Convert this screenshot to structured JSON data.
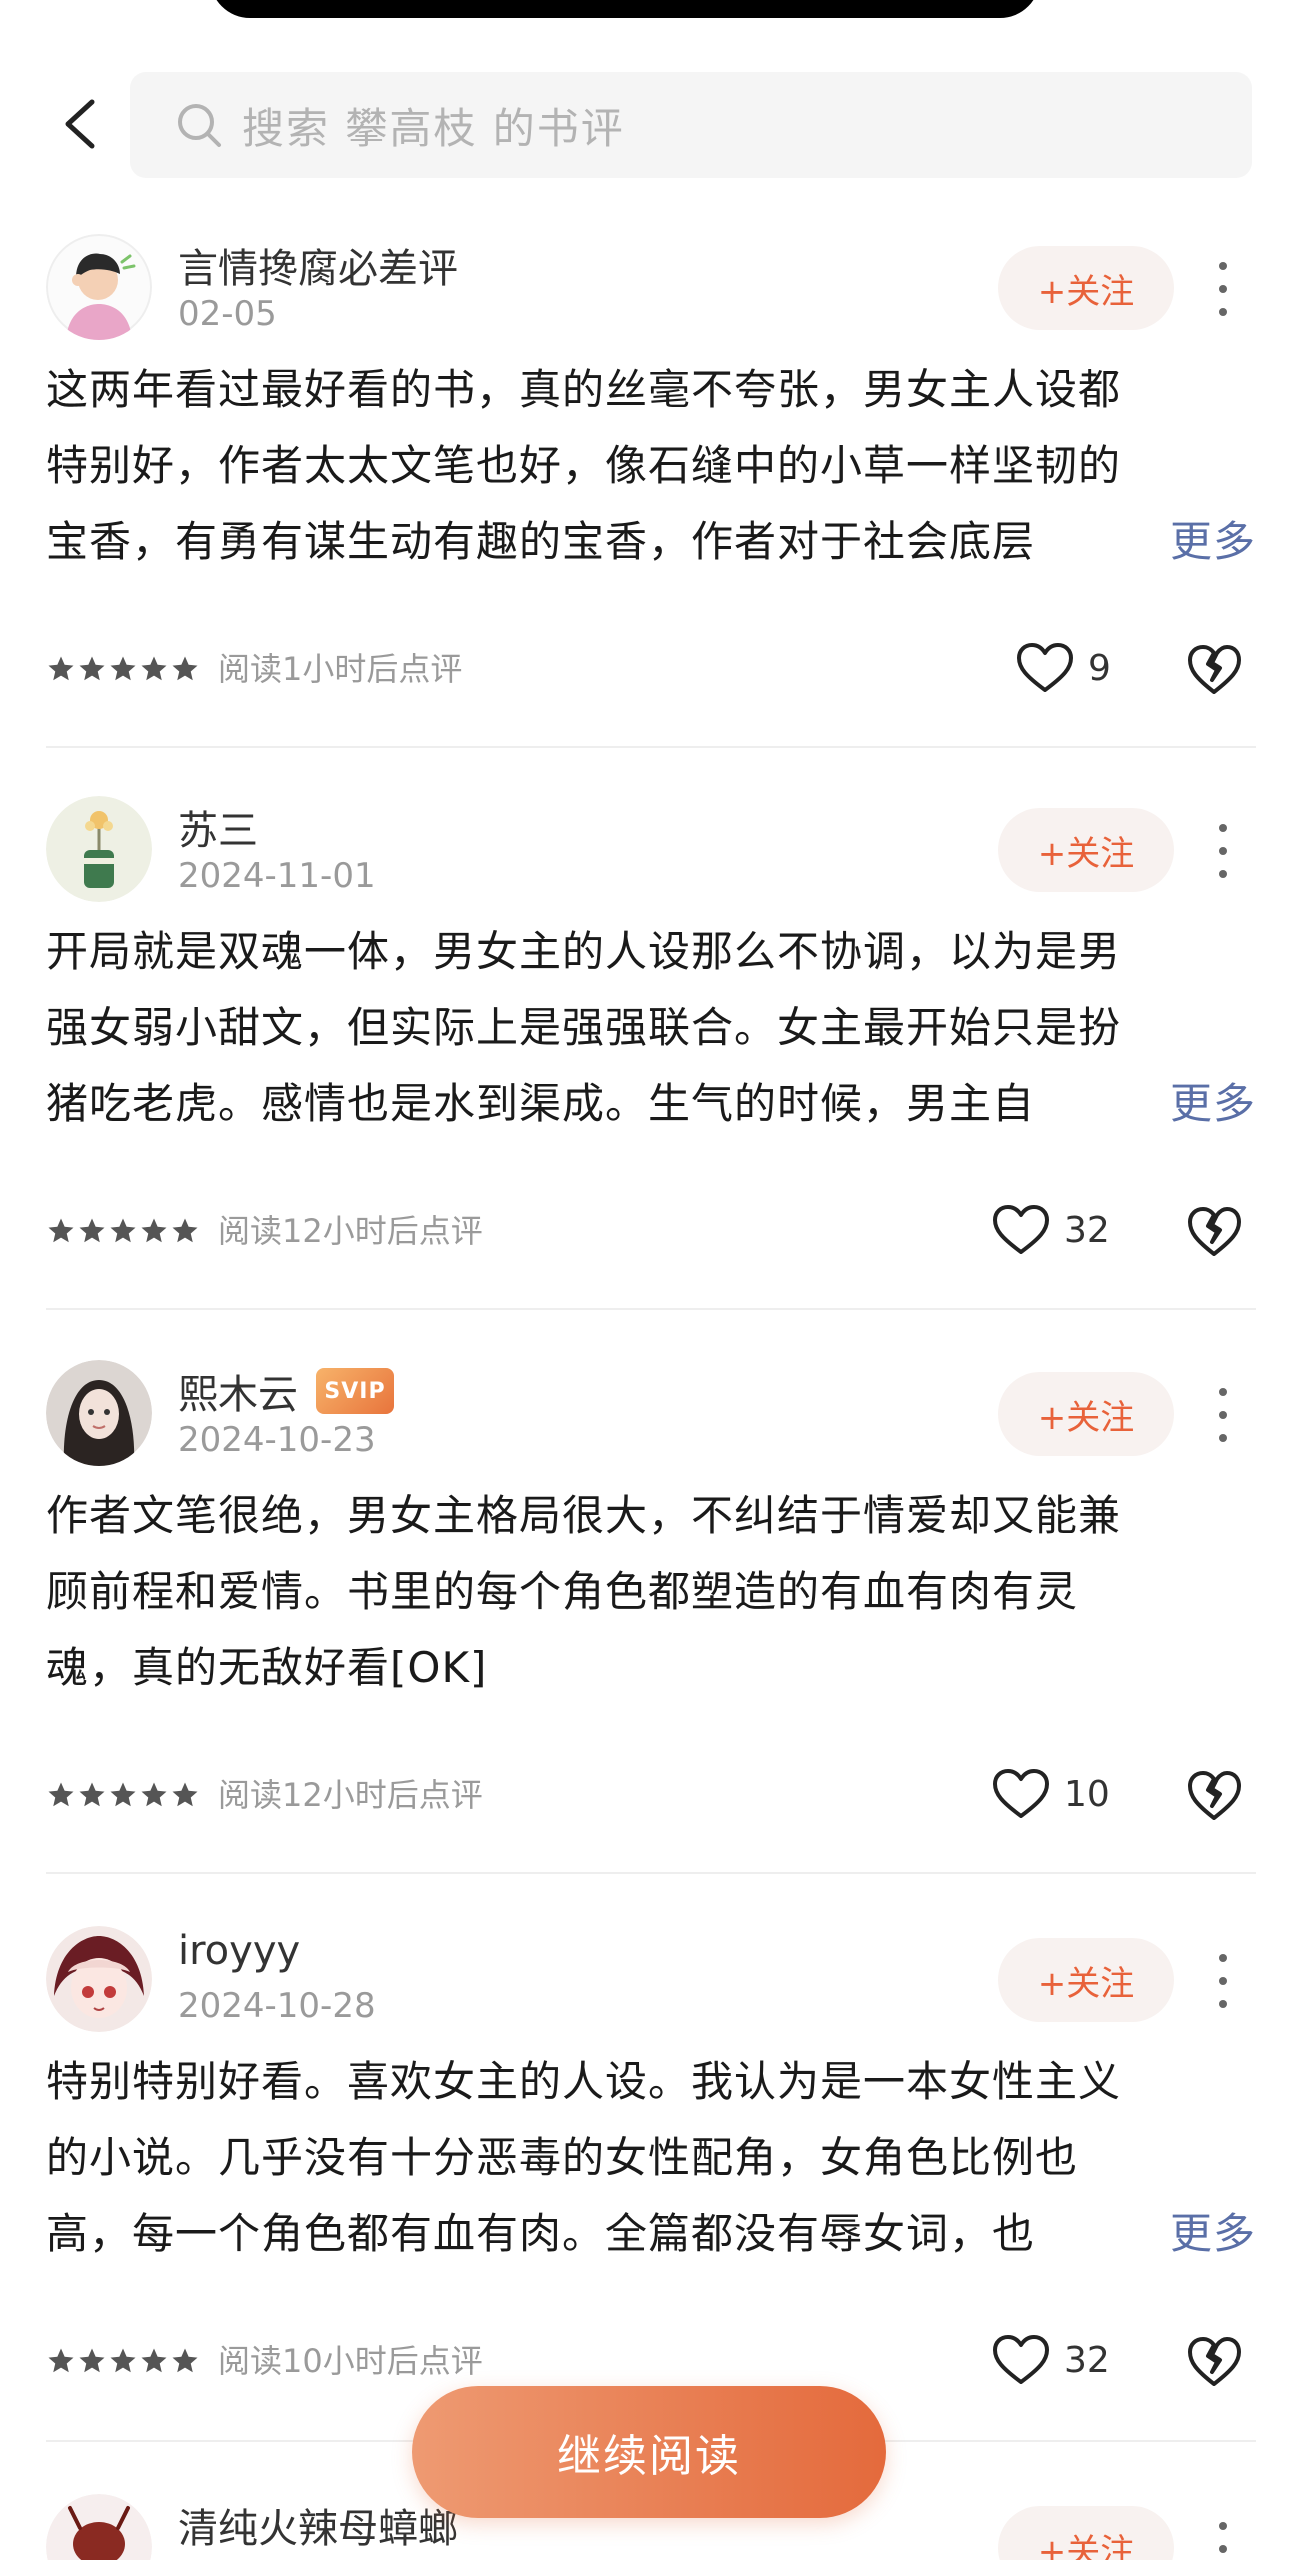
{
  "search": {
    "placeholder": "搜索 攀高枝 的书评"
  },
  "reviews": [
    {
      "username": "言情搀腐必差评",
      "date": "02-05",
      "follow_label": "+关注",
      "lines": [
        "这两年看过最好看的书，真的丝毫不夸张，男女主人设都",
        "特别好，作者太太文笔也好，像石缝中的小草一样坚韧的",
        "宝香，有勇有谋生动有趣的宝香，作者对于社会底层"
      ],
      "more_label": "更多",
      "read_note": "阅读1小时后点评",
      "likes": "9",
      "rating": 5
    },
    {
      "username": "苏三",
      "date": "2024-11-01",
      "follow_label": "+关注",
      "lines": [
        "开局就是双魂一体，男女主的人设那么不协调，以为是男",
        "强女弱小甜文，但实际上是强强联合。女主最开始只是扮",
        "猪吃老虎。感情也是水到渠成。生气的时候，男主自"
      ],
      "more_label": "更多",
      "read_note": "阅读12小时后点评",
      "likes": "32",
      "rating": 5
    },
    {
      "username": "熙木云",
      "badge": "SVIP",
      "date": "2024-10-23",
      "follow_label": "+关注",
      "lines": [
        "作者文笔很绝，男女主格局很大，不纠结于情爱却又能兼",
        "顾前程和爱情。书里的每个角色都塑造的有血有肉有灵",
        "魂，真的无敌好看[OK]"
      ],
      "read_note": "阅读12小时后点评",
      "likes": "10",
      "rating": 5
    },
    {
      "username": "iroyyy",
      "date": "2024-10-28",
      "follow_label": "+关注",
      "lines": [
        "特别特别好看。喜欢女主的人设。我认为是一本女性主义",
        "的小说。几乎没有十分恶毒的女性配角，女角色比例也",
        "高，每一个角色都有血有肉。全篇都没有辱女词，也"
      ],
      "more_label": "更多",
      "read_note": "阅读10小时后点评",
      "likes": "32",
      "rating": 5
    },
    {
      "username": "清纯火辣母蟑螂",
      "follow_label": "+关注"
    }
  ],
  "continue_label": "继续阅读",
  "colors": {
    "accent": "#e8623a",
    "link": "#5a6fa7",
    "muted": "#9a9a9a"
  }
}
